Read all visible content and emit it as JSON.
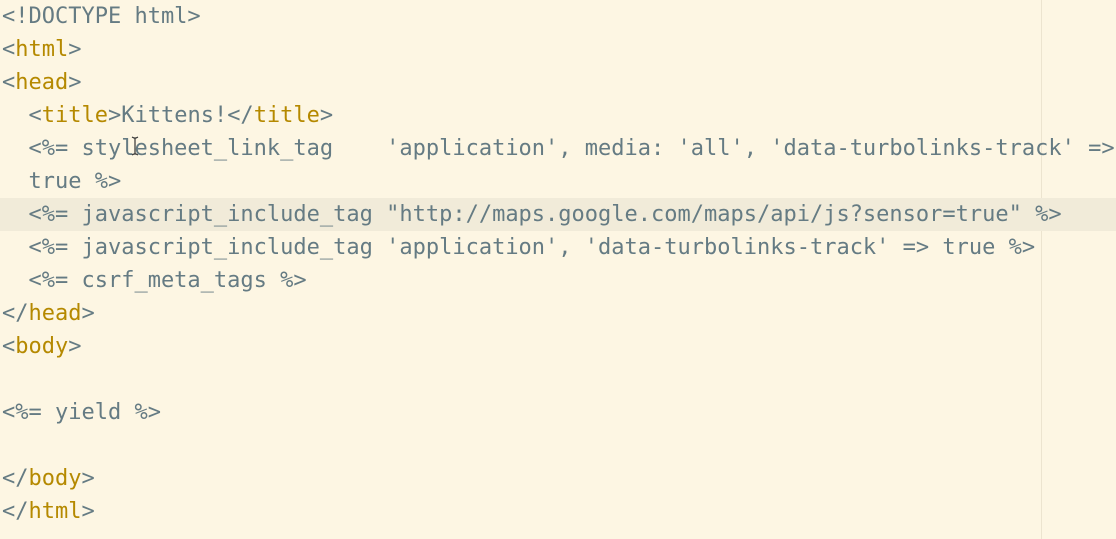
{
  "editor": {
    "lines": [
      {
        "segs": [
          {
            "t": "<!DOCTYPE html>",
            "c": "p"
          }
        ]
      },
      {
        "segs": [
          {
            "t": "<",
            "c": "p"
          },
          {
            "t": "html",
            "c": "tag"
          },
          {
            "t": ">",
            "c": "p"
          }
        ]
      },
      {
        "segs": [
          {
            "t": "<",
            "c": "p"
          },
          {
            "t": "head",
            "c": "tag"
          },
          {
            "t": ">",
            "c": "p"
          }
        ]
      },
      {
        "segs": [
          {
            "t": "  <",
            "c": "p"
          },
          {
            "t": "title",
            "c": "tag"
          },
          {
            "t": ">Kittens!</",
            "c": "p"
          },
          {
            "t": "title",
            "c": "tag"
          },
          {
            "t": ">",
            "c": "p"
          }
        ]
      },
      {
        "segs": [
          {
            "t": "  <%= stylesheet_link_tag    'application', media: 'all', 'data-turbolinks-track' =>",
            "c": "p"
          }
        ]
      },
      {
        "segs": [
          {
            "t": "  true %>",
            "c": "p"
          }
        ]
      },
      {
        "segs": [
          {
            "t": "  <%= javascript_include_tag \"http://maps.google.com/maps/api/js?sensor=true\" %>",
            "c": "p"
          }
        ],
        "current": true
      },
      {
        "segs": [
          {
            "t": "  <%= javascript_include_tag 'application', 'data-turbolinks-track' => true %>",
            "c": "p"
          }
        ]
      },
      {
        "segs": [
          {
            "t": "  <%= csrf_meta_tags %>",
            "c": "p"
          }
        ]
      },
      {
        "segs": [
          {
            "t": "</",
            "c": "p"
          },
          {
            "t": "head",
            "c": "tag"
          },
          {
            "t": ">",
            "c": "p"
          }
        ]
      },
      {
        "segs": [
          {
            "t": "<",
            "c": "p"
          },
          {
            "t": "body",
            "c": "tag"
          },
          {
            "t": ">",
            "c": "p"
          }
        ]
      },
      {
        "segs": [
          {
            "t": "",
            "c": "p"
          }
        ]
      },
      {
        "segs": [
          {
            "t": "<%= yield %>",
            "c": "p"
          }
        ]
      },
      {
        "segs": [
          {
            "t": "",
            "c": "p"
          }
        ]
      },
      {
        "segs": [
          {
            "t": "</",
            "c": "p"
          },
          {
            "t": "body",
            "c": "tag"
          },
          {
            "t": ">",
            "c": "p"
          }
        ]
      },
      {
        "segs": [
          {
            "t": "</",
            "c": "p"
          },
          {
            "t": "html",
            "c": "tag"
          },
          {
            "t": ">",
            "c": "p"
          }
        ]
      }
    ]
  },
  "colors": {
    "background": "#fdf6e3",
    "current_line": "#f1ebd9",
    "text": "#657b83",
    "tag_name": "#b58900"
  },
  "icons": {
    "mouse_cursor": "text-ibeam-cursor-icon"
  }
}
